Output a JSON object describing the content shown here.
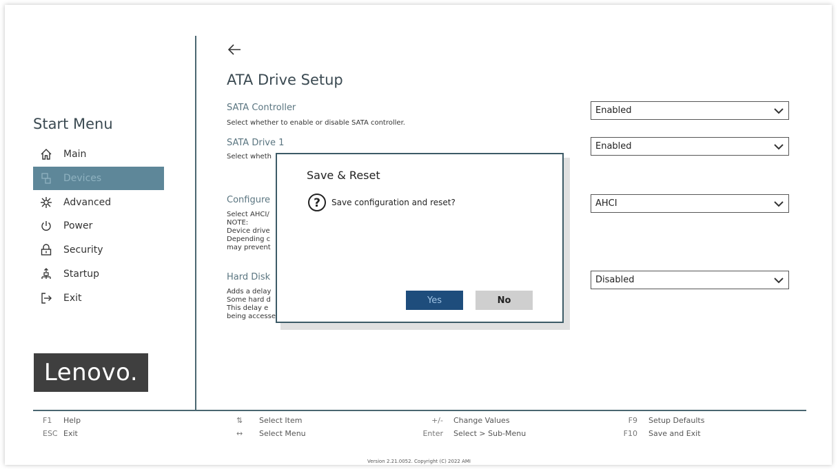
{
  "sidebar": {
    "title": "Start Menu",
    "items": [
      {
        "label": "Main",
        "icon": "home-icon"
      },
      {
        "label": "Devices",
        "icon": "devices-icon",
        "selected": true
      },
      {
        "label": "Advanced",
        "icon": "advanced-icon"
      },
      {
        "label": "Power",
        "icon": "power-icon"
      },
      {
        "label": "Security",
        "icon": "lock-icon"
      },
      {
        "label": "Startup",
        "icon": "startup-icon"
      },
      {
        "label": "Exit",
        "icon": "exit-icon"
      }
    ],
    "logo": "Lenovo."
  },
  "main": {
    "title": "ATA Drive Setup",
    "settings": [
      {
        "name": "SATA Controller",
        "desc": [
          "Select whether to enable or disable SATA controller."
        ],
        "value": "Enabled"
      },
      {
        "name": "SATA Drive 1",
        "desc": [
          "Select wheth"
        ],
        "value": "Enabled"
      },
      {
        "name": "Configure",
        "desc": [
          "Select AHCI/",
          "NOTE:",
          "Device drive",
          "Depending c",
          "may prevent"
        ],
        "value": "AHCI"
      },
      {
        "name": "Hard Disk",
        "desc": [
          "Adds a delay",
          "Some hard d",
          "This delay e",
          "being accesse"
        ],
        "value": "Disabled"
      }
    ]
  },
  "dialog": {
    "title": "Save & Reset",
    "message": "Save configuration and reset?",
    "yes_label": "Yes",
    "no_label": "No"
  },
  "footer": {
    "keys": [
      {
        "key": "F1",
        "action": "Help"
      },
      {
        "key": "ESC",
        "action": "Exit"
      },
      {
        "key": "⇅",
        "action": "Select Item"
      },
      {
        "key": "↔",
        "action": "Select Menu"
      },
      {
        "key": "+/-",
        "action": "Change Values"
      },
      {
        "key": "Enter",
        "action": "Select > Sub-Menu"
      },
      {
        "key": "F9",
        "action": "Setup Defaults"
      },
      {
        "key": "F10",
        "action": "Save and Exit"
      }
    ],
    "version": "Version 2.21.0052. Copyright (C) 2022 AMI"
  },
  "colors": {
    "accent": "#5e8799",
    "divider": "#4a6670",
    "dialog_border": "#3c5a66",
    "yes_button": "#1e4d7c"
  }
}
